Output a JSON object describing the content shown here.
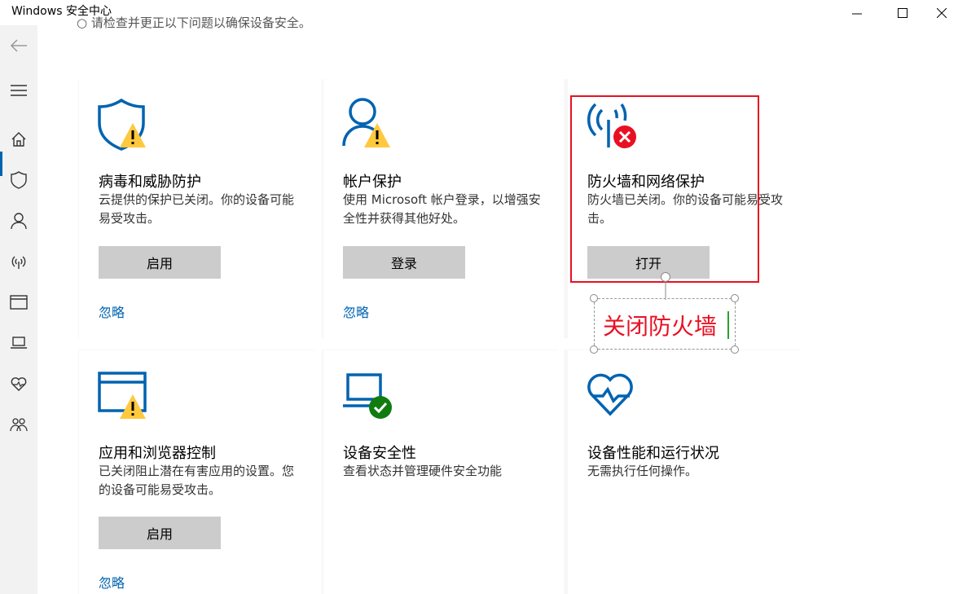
{
  "window": {
    "title": "Windows 安全中心"
  },
  "header": {
    "clipped_text": "○ 请检查并更正以下问题以确保设备安全。"
  },
  "sidebar": {
    "items": [
      "back-arrow",
      "menu",
      "home",
      "shield",
      "person",
      "wifi",
      "app-window",
      "laptop",
      "health-heart",
      "family"
    ]
  },
  "cards": [
    {
      "title": "病毒和威胁防护",
      "desc": "云提供的保护已关闭。你的设备可能易受攻击。",
      "button": "启用",
      "link": "忽略"
    },
    {
      "title": "帐户保护",
      "desc": "使用 Microsoft 帐户登录，以增强安全性并获得其他好处。",
      "button": "登录",
      "link": "忽略"
    },
    {
      "title": "防火墙和网络保护",
      "desc": "防火墙已关闭。你的设备可能易受攻击。",
      "button": "打开"
    },
    {
      "title": "应用和浏览器控制",
      "desc": "已关闭阻止潜在有害应用的设置。您的设备可能易受攻击。",
      "button": "启用",
      "link": "忽略"
    },
    {
      "title": "设备安全性",
      "desc": "查看状态并管理硬件安全功能"
    },
    {
      "title": "设备性能和运行状况",
      "desc": "无需执行任何操作。"
    }
  ],
  "annotation": {
    "text": "关闭防火墙"
  },
  "colors": {
    "accent": "#0063b1",
    "warning": "#ffc83d",
    "error": "#e81123",
    "ok": "#107c10"
  }
}
